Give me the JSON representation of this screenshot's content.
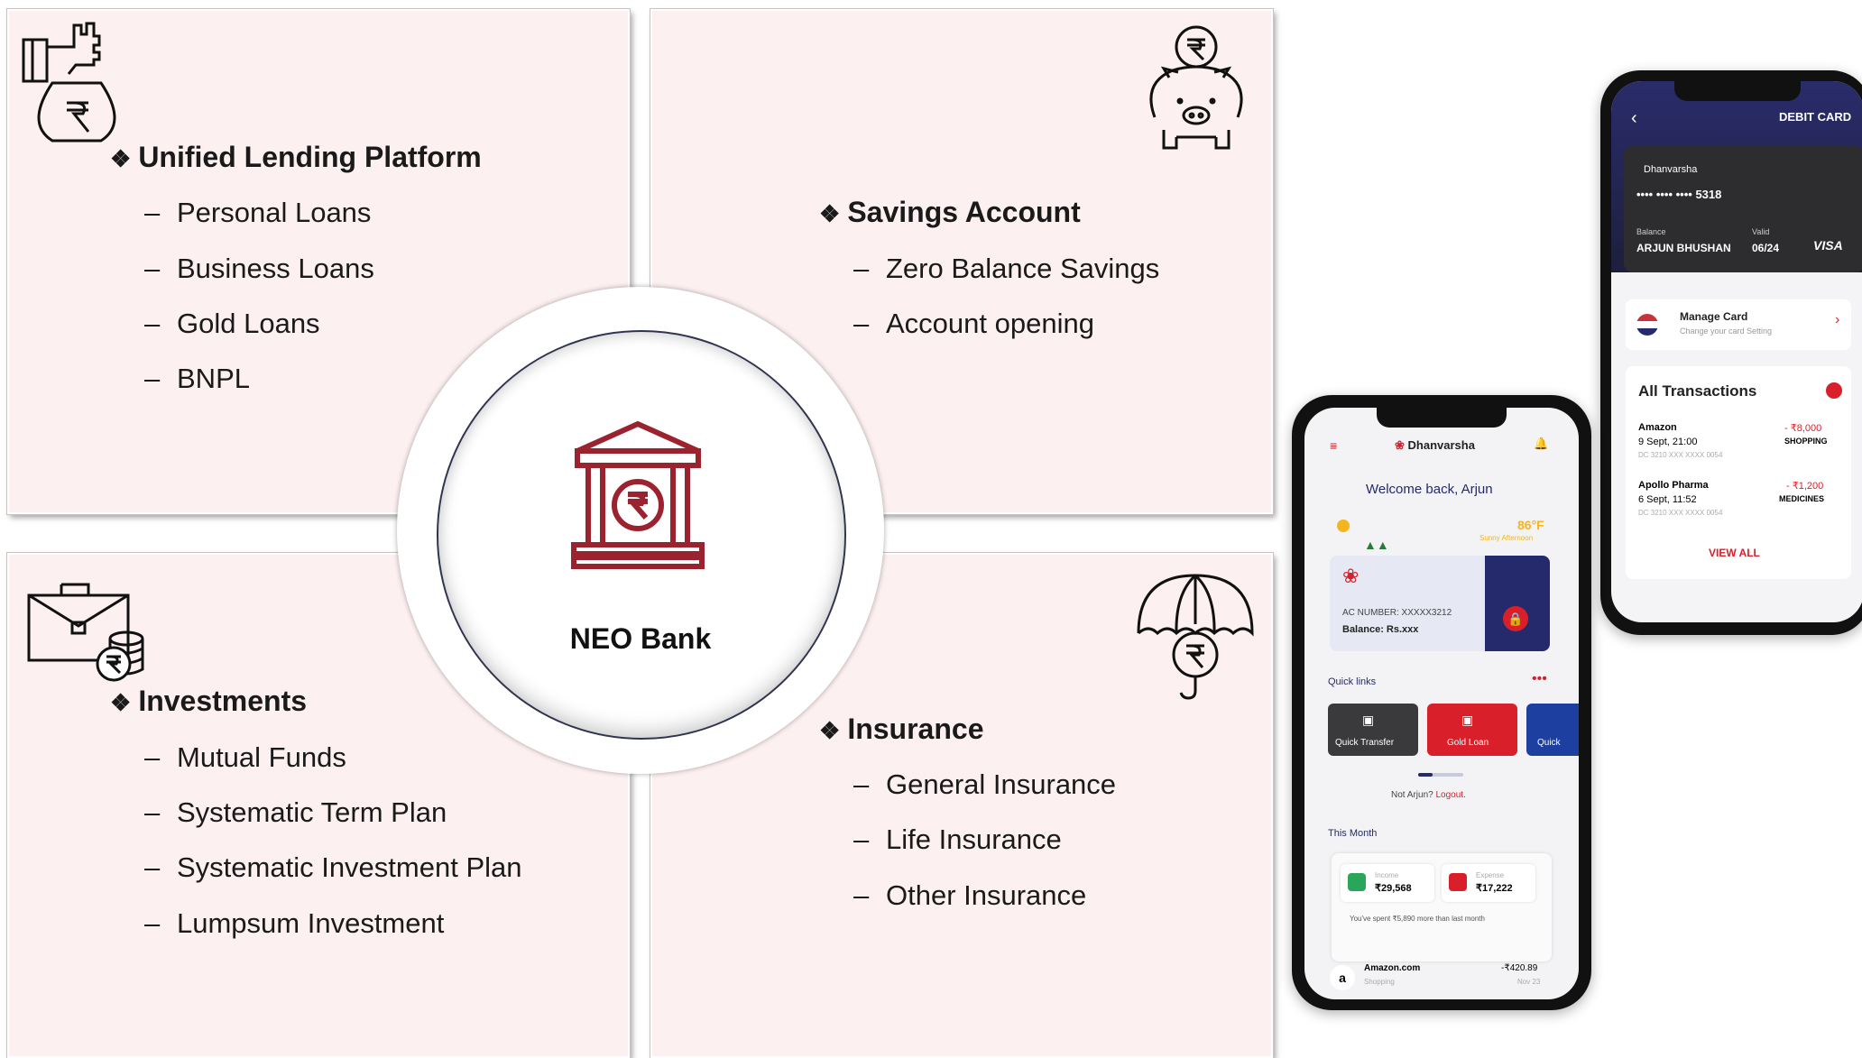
{
  "center": {
    "label": "NEO Bank"
  },
  "quadrants": {
    "lending": {
      "title": "Unified Lending  Platform",
      "items": [
        "Personal Loans",
        "Business Loans",
        "Gold Loans",
        "BNPL"
      ]
    },
    "savings": {
      "title": "Savings Account",
      "items": [
        "Zero Balance Savings",
        "Account opening"
      ]
    },
    "investments": {
      "title": "Investments",
      "items": [
        "Mutual Funds",
        "Systematic Term Plan",
        "Systematic Investment Plan",
        "Lumpsum Investment"
      ]
    },
    "insurance": {
      "title": "Insurance",
      "items": [
        "General Insurance",
        "Life Insurance",
        "Other Insurance"
      ]
    }
  },
  "bullet_glyph": "❖",
  "dash_glyph": "–",
  "phone_front": {
    "brand": "Dhanvarsha",
    "welcome": "Welcome back, Arjun",
    "temperature": "86°F",
    "weather": "Sunny Afternoon",
    "account_number": "AC NUMBER: XXXXX3212",
    "balance": "Balance: Rs.xxx",
    "quick_links_label": "Quick links",
    "quick_links": [
      "Quick Transfer",
      "Gold Loan",
      "Quick"
    ],
    "not_user": "Not Arjun?",
    "logout": "Logout.",
    "this_month": "This Month",
    "income_label": "Income",
    "income_value": "₹29,568",
    "expense_label": "Expense",
    "expense_value": "₹17,222",
    "spent_note": "You've spent ₹5,890 more than last month",
    "txn_merchant": "Amazon.com",
    "txn_category": "Shopping",
    "txn_amount": "-₹420.89",
    "txn_date": "Nov 23"
  },
  "phone_back": {
    "header": "DEBIT CARD",
    "brand": "Dhanvarsha",
    "card_number": "•••• •••• ••••  5318",
    "balance_label": "Balance",
    "holder": "ARJUN BHUSHAN",
    "valid_label": "Valid",
    "valid": "06/24",
    "network": "VISA",
    "manage_title": "Manage Card",
    "manage_sub": "Change your card Setting",
    "all_txn": "All Transactions",
    "transactions": [
      {
        "merchant": "Amazon",
        "amount": "- ₹8,000",
        "date": "9 Sept, 21:00",
        "category": "SHOPPING",
        "card": "DC 3210 XXX XXXX 0054"
      },
      {
        "merchant": "Apollo Pharma",
        "amount": "- ₹1,200",
        "date": "6 Sept, 11:52",
        "category": "MEDICINES",
        "card": "DC 3210 XXX XXXX 0054"
      }
    ],
    "view_all": "VIEW ALL"
  },
  "colors": {
    "panel": "#fdf0f1",
    "accent_red": "#9b2330",
    "app_red": "#d81f2a",
    "app_navy": "#242a6b"
  }
}
